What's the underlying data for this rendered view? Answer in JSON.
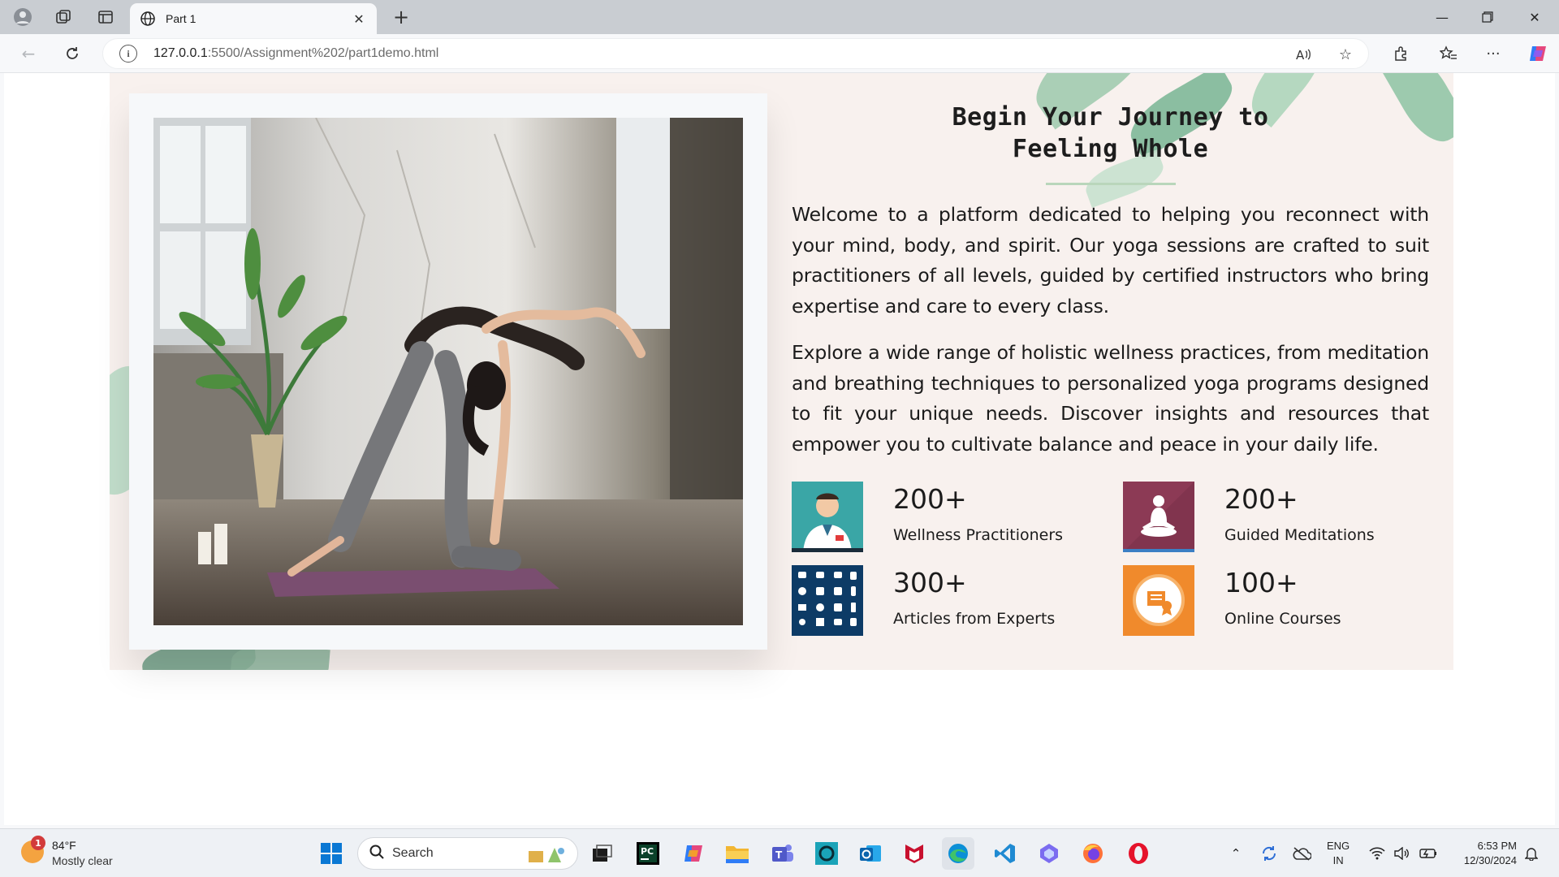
{
  "tab": {
    "title": "Part 1"
  },
  "address": {
    "host": "127.0.0.1",
    "path": ":5500/Assignment%202/part1demo.html"
  },
  "page": {
    "heading_line1": "Begin Your Journey to",
    "heading_line2": "Feeling Whole",
    "para1": "Welcome to a platform dedicated to helping you reconnect with your mind, body, and spirit. Our yoga sessions are crafted to suit practitioners of all levels, guided by certified instructors who bring expertise and care to every class.",
    "para2": "Explore a wide range of holistic wellness practices, from meditation and breathing techniques to personalized yoga programs designed to fit your unique needs. Discover insights and resources that empower you to cultivate balance and peace in your daily life.",
    "stats": [
      {
        "number": "200+",
        "label": "Wellness Practitioners",
        "icon": "doctor-icon",
        "color": "#3aa6a6"
      },
      {
        "number": "200+",
        "label": "Guided Meditations",
        "icon": "meditation-icon",
        "color": "#8c3a55"
      },
      {
        "number": "300+",
        "label": "Articles from Experts",
        "icon": "medical-grid-icon",
        "color": "#0d3b66"
      },
      {
        "number": "100+",
        "label": "Online Courses",
        "icon": "certificate-icon",
        "color": "#f08a2c"
      }
    ]
  },
  "taskbar": {
    "weather_temp": "84°F",
    "weather_cond": "Mostly clear",
    "weather_badge": "1",
    "search_placeholder": "Search",
    "lang_line1": "ENG",
    "lang_line2": "IN",
    "time": "6:53 PM",
    "date": "12/30/2024"
  }
}
